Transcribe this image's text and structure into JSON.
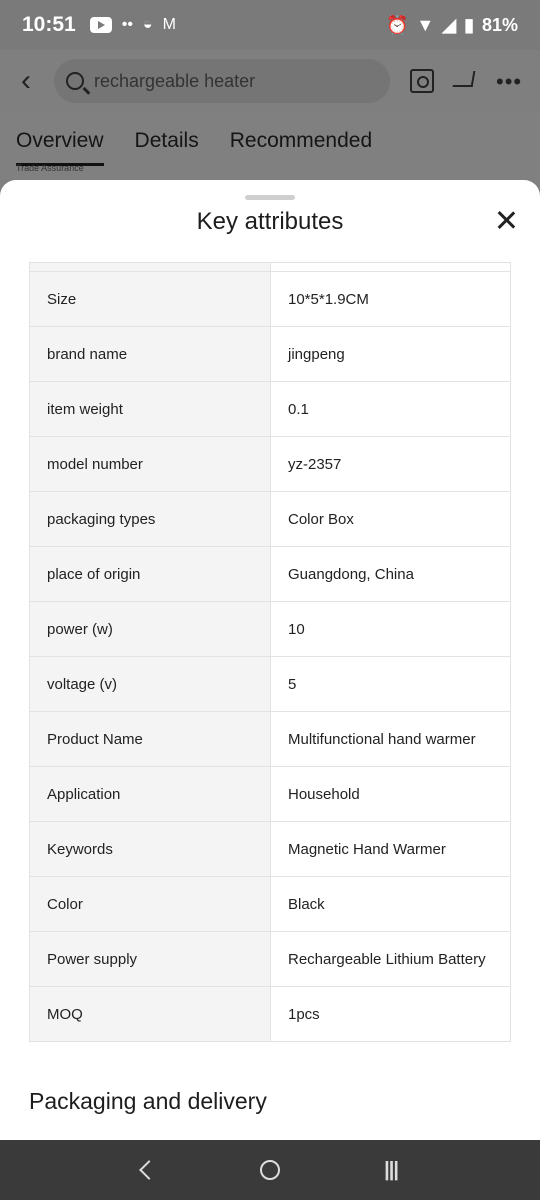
{
  "status_bar": {
    "time": "10:51",
    "battery": "81%"
  },
  "header": {
    "search_text": "rechargeable heater"
  },
  "tabs": [
    {
      "label": "Overview"
    },
    {
      "label": "Details"
    },
    {
      "label": "Recommended"
    }
  ],
  "trade_assurance": "Trade Assurance",
  "sheet": {
    "title": "Key attributes",
    "attributes": [
      {
        "key": "Size",
        "value": "10*5*1.9CM"
      },
      {
        "key": "brand name",
        "value": "jingpeng"
      },
      {
        "key": "item weight",
        "value": "0.1"
      },
      {
        "key": "model number",
        "value": "yz-2357"
      },
      {
        "key": "packaging types",
        "value": "Color Box"
      },
      {
        "key": "place of origin",
        "value": "Guangdong, China"
      },
      {
        "key": "power (w)",
        "value": "10"
      },
      {
        "key": "voltage (v)",
        "value": "5"
      },
      {
        "key": "Product Name",
        "value": "Multifunctional hand warmer"
      },
      {
        "key": "Application",
        "value": "Household"
      },
      {
        "key": "Keywords",
        "value": "Magnetic Hand Warmer"
      },
      {
        "key": "Color",
        "value": "Black"
      },
      {
        "key": "Power supply",
        "value": "Rechargeable Lithium Battery"
      },
      {
        "key": "MOQ",
        "value": "1pcs"
      }
    ],
    "section_title": "Packaging and delivery"
  }
}
